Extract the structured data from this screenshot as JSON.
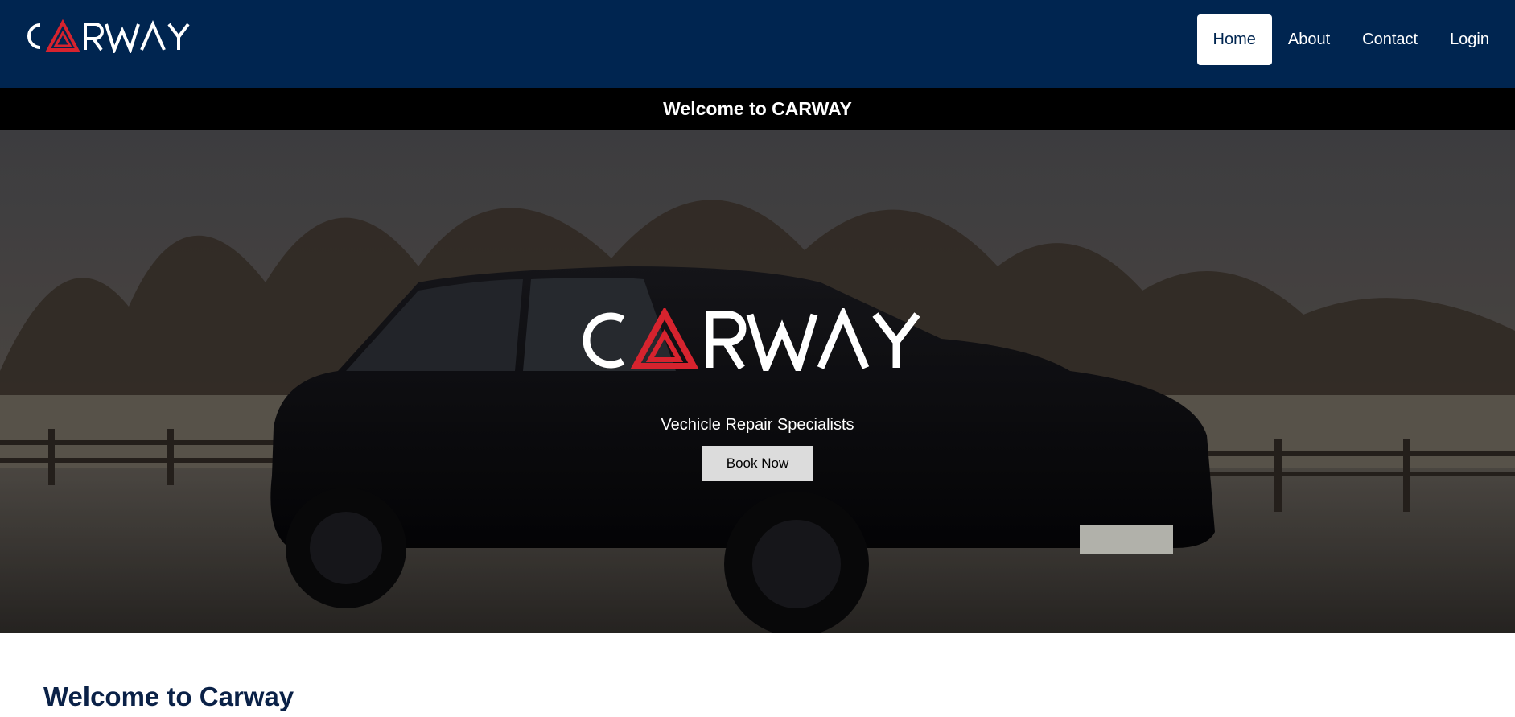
{
  "brand": {
    "name": "CARWAY",
    "accent_color": "#d6232e",
    "nav_bg": "#002550"
  },
  "nav": {
    "items": [
      {
        "label": "Home",
        "active": true
      },
      {
        "label": "About",
        "active": false
      },
      {
        "label": "Contact",
        "active": false
      },
      {
        "label": "Login",
        "active": false
      }
    ]
  },
  "banner": {
    "text": "Welcome to CARWAY"
  },
  "hero": {
    "tagline": "Vechicle Repair Specialists",
    "button_label": "Book Now",
    "background": "dark SUV parked in frosty field with bare trees"
  },
  "main": {
    "heading": "Welcome to Carway"
  }
}
